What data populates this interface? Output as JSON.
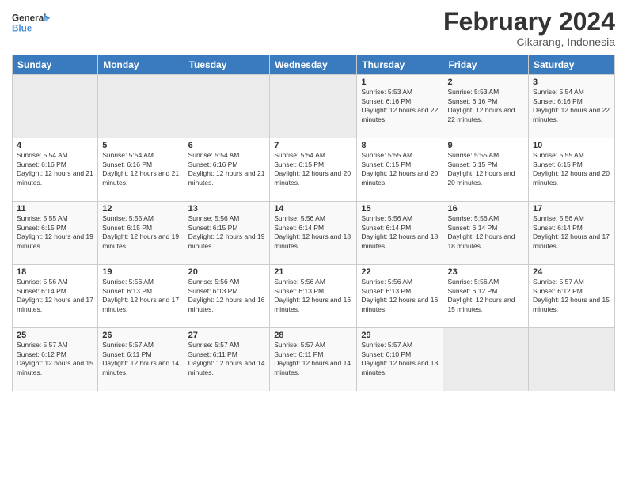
{
  "header": {
    "month_title": "February 2024",
    "location": "Cikarang, Indonesia",
    "logo_line1": "General",
    "logo_line2": "Blue"
  },
  "days_of_week": [
    "Sunday",
    "Monday",
    "Tuesday",
    "Wednesday",
    "Thursday",
    "Friday",
    "Saturday"
  ],
  "weeks": [
    [
      {
        "day": "",
        "empty": true
      },
      {
        "day": "",
        "empty": true
      },
      {
        "day": "",
        "empty": true
      },
      {
        "day": "",
        "empty": true
      },
      {
        "day": "1",
        "sunrise": "5:53 AM",
        "sunset": "6:16 PM",
        "daylight": "12 hours and 22 minutes."
      },
      {
        "day": "2",
        "sunrise": "5:53 AM",
        "sunset": "6:16 PM",
        "daylight": "12 hours and 22 minutes."
      },
      {
        "day": "3",
        "sunrise": "5:54 AM",
        "sunset": "6:16 PM",
        "daylight": "12 hours and 22 minutes."
      }
    ],
    [
      {
        "day": "4",
        "sunrise": "5:54 AM",
        "sunset": "6:16 PM",
        "daylight": "12 hours and 21 minutes."
      },
      {
        "day": "5",
        "sunrise": "5:54 AM",
        "sunset": "6:16 PM",
        "daylight": "12 hours and 21 minutes."
      },
      {
        "day": "6",
        "sunrise": "5:54 AM",
        "sunset": "6:16 PM",
        "daylight": "12 hours and 21 minutes."
      },
      {
        "day": "7",
        "sunrise": "5:54 AM",
        "sunset": "6:15 PM",
        "daylight": "12 hours and 20 minutes."
      },
      {
        "day": "8",
        "sunrise": "5:55 AM",
        "sunset": "6:15 PM",
        "daylight": "12 hours and 20 minutes."
      },
      {
        "day": "9",
        "sunrise": "5:55 AM",
        "sunset": "6:15 PM",
        "daylight": "12 hours and 20 minutes."
      },
      {
        "day": "10",
        "sunrise": "5:55 AM",
        "sunset": "6:15 PM",
        "daylight": "12 hours and 20 minutes."
      }
    ],
    [
      {
        "day": "11",
        "sunrise": "5:55 AM",
        "sunset": "6:15 PM",
        "daylight": "12 hours and 19 minutes."
      },
      {
        "day": "12",
        "sunrise": "5:55 AM",
        "sunset": "6:15 PM",
        "daylight": "12 hours and 19 minutes."
      },
      {
        "day": "13",
        "sunrise": "5:56 AM",
        "sunset": "6:15 PM",
        "daylight": "12 hours and 19 minutes."
      },
      {
        "day": "14",
        "sunrise": "5:56 AM",
        "sunset": "6:14 PM",
        "daylight": "12 hours and 18 minutes."
      },
      {
        "day": "15",
        "sunrise": "5:56 AM",
        "sunset": "6:14 PM",
        "daylight": "12 hours and 18 minutes."
      },
      {
        "day": "16",
        "sunrise": "5:56 AM",
        "sunset": "6:14 PM",
        "daylight": "12 hours and 18 minutes."
      },
      {
        "day": "17",
        "sunrise": "5:56 AM",
        "sunset": "6:14 PM",
        "daylight": "12 hours and 17 minutes."
      }
    ],
    [
      {
        "day": "18",
        "sunrise": "5:56 AM",
        "sunset": "6:14 PM",
        "daylight": "12 hours and 17 minutes."
      },
      {
        "day": "19",
        "sunrise": "5:56 AM",
        "sunset": "6:13 PM",
        "daylight": "12 hours and 17 minutes."
      },
      {
        "day": "20",
        "sunrise": "5:56 AM",
        "sunset": "6:13 PM",
        "daylight": "12 hours and 16 minutes."
      },
      {
        "day": "21",
        "sunrise": "5:56 AM",
        "sunset": "6:13 PM",
        "daylight": "12 hours and 16 minutes."
      },
      {
        "day": "22",
        "sunrise": "5:56 AM",
        "sunset": "6:13 PM",
        "daylight": "12 hours and 16 minutes."
      },
      {
        "day": "23",
        "sunrise": "5:56 AM",
        "sunset": "6:12 PM",
        "daylight": "12 hours and 15 minutes."
      },
      {
        "day": "24",
        "sunrise": "5:57 AM",
        "sunset": "6:12 PM",
        "daylight": "12 hours and 15 minutes."
      }
    ],
    [
      {
        "day": "25",
        "sunrise": "5:57 AM",
        "sunset": "6:12 PM",
        "daylight": "12 hours and 15 minutes."
      },
      {
        "day": "26",
        "sunrise": "5:57 AM",
        "sunset": "6:11 PM",
        "daylight": "12 hours and 14 minutes."
      },
      {
        "day": "27",
        "sunrise": "5:57 AM",
        "sunset": "6:11 PM",
        "daylight": "12 hours and 14 minutes."
      },
      {
        "day": "28",
        "sunrise": "5:57 AM",
        "sunset": "6:11 PM",
        "daylight": "12 hours and 14 minutes."
      },
      {
        "day": "29",
        "sunrise": "5:57 AM",
        "sunset": "6:10 PM",
        "daylight": "12 hours and 13 minutes."
      },
      {
        "day": "",
        "empty": true
      },
      {
        "day": "",
        "empty": true
      }
    ]
  ]
}
